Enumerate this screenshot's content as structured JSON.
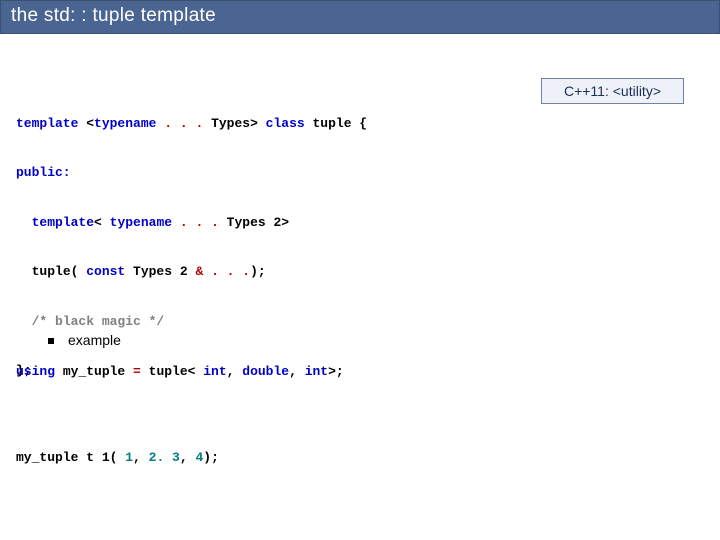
{
  "title": "the std: : tuple template",
  "badge": "C++11: <utility>",
  "code": {
    "line1": {
      "kw_template": "template",
      "tpl_open": " <",
      "kw_typename": "typename",
      "ellipsis": " . . . ",
      "types_brace": "Types> ",
      "kw_class": "class ",
      "tuple_brace": "tuple {"
    },
    "line2": {
      "kw_public": "public:"
    },
    "line3": {
      "indent": "  ",
      "kw_template": "template",
      "open": "< ",
      "kw_typename": "typename",
      "ellipsis": " . . . ",
      "types2": "Types 2>"
    },
    "line4": {
      "indent": "  ",
      "ctor": "tuple( ",
      "kw_const": "const ",
      "types2": "Types 2 ",
      "amp": "& ",
      "ellipsis": ". . .",
      "close": ");"
    },
    "line5": {
      "indent": "  ",
      "comment": "/* black magic */"
    },
    "line6": {
      "close": "};"
    }
  },
  "example_label": "example",
  "usage": {
    "line1": {
      "kw_using": "using ",
      "name": "my_tuple ",
      "eq": "= ",
      "tuple_open": "tuple< ",
      "kw_int1": "int",
      "c1": ", ",
      "kw_double": "double",
      "c2": ", ",
      "kw_int2": "int",
      "close": ">;"
    },
    "line2": {
      "type": "my_tuple ",
      "var": "t 1( ",
      "n1": "1",
      "c1": ", ",
      "n2": "2. 3",
      "c2": ", ",
      "n3": "4",
      "close": ");"
    }
  }
}
